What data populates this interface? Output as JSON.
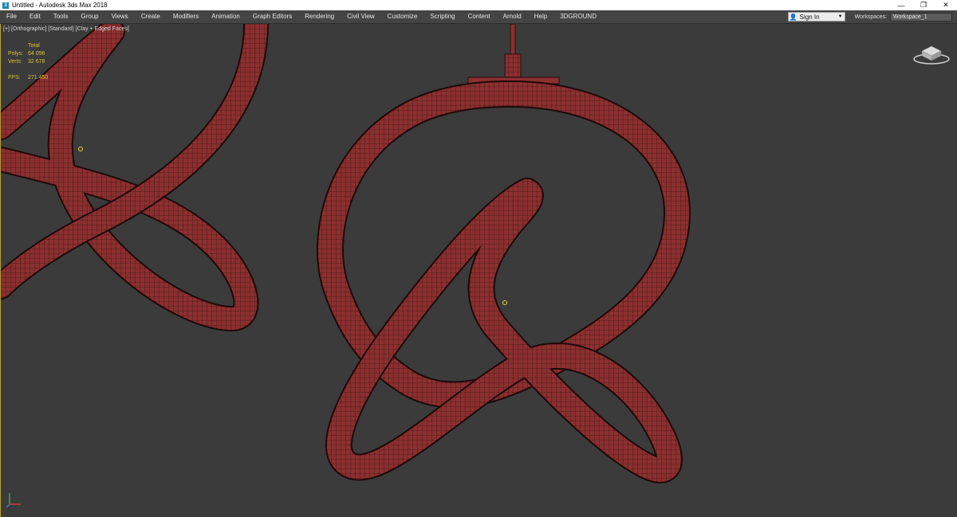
{
  "window": {
    "title": "Untitled - Autodesk 3ds Max 2018",
    "app_icon": "3",
    "controls": [
      "—",
      "❐",
      "✕"
    ]
  },
  "menubar": {
    "items": [
      "File",
      "Edit",
      "Tools",
      "Group",
      "Views",
      "Create",
      "Modifiers",
      "Animation",
      "Graph Editors",
      "Rendering",
      "Civil View",
      "Customize",
      "Scripting",
      "Content",
      "Arnold",
      "Help",
      "3DGROUND"
    ],
    "sign_in": "Sign In",
    "workspaces_label": "Workspaces:",
    "workspace_value": "Workspace_1"
  },
  "viewport": {
    "label": {
      "plus": "[+]",
      "view": "[Orthographic]",
      "shading": "[Standard]",
      "style": "[Clay + Edged Faces]"
    },
    "stats": {
      "total_label": "Total",
      "polys_label": "Polys:",
      "polys_value": "64 096",
      "verts_label": "Verts:",
      "verts_value": "32 678",
      "fps_label": "FPS:",
      "fps_value": "271.450"
    },
    "colors": {
      "background": "#3b3b3b",
      "mesh": "#8a2e2e",
      "wire": "#2a0d0d",
      "stats": "#d9c33a"
    },
    "icons": [
      "viewcube-icon",
      "axis-tripod-icon"
    ]
  }
}
